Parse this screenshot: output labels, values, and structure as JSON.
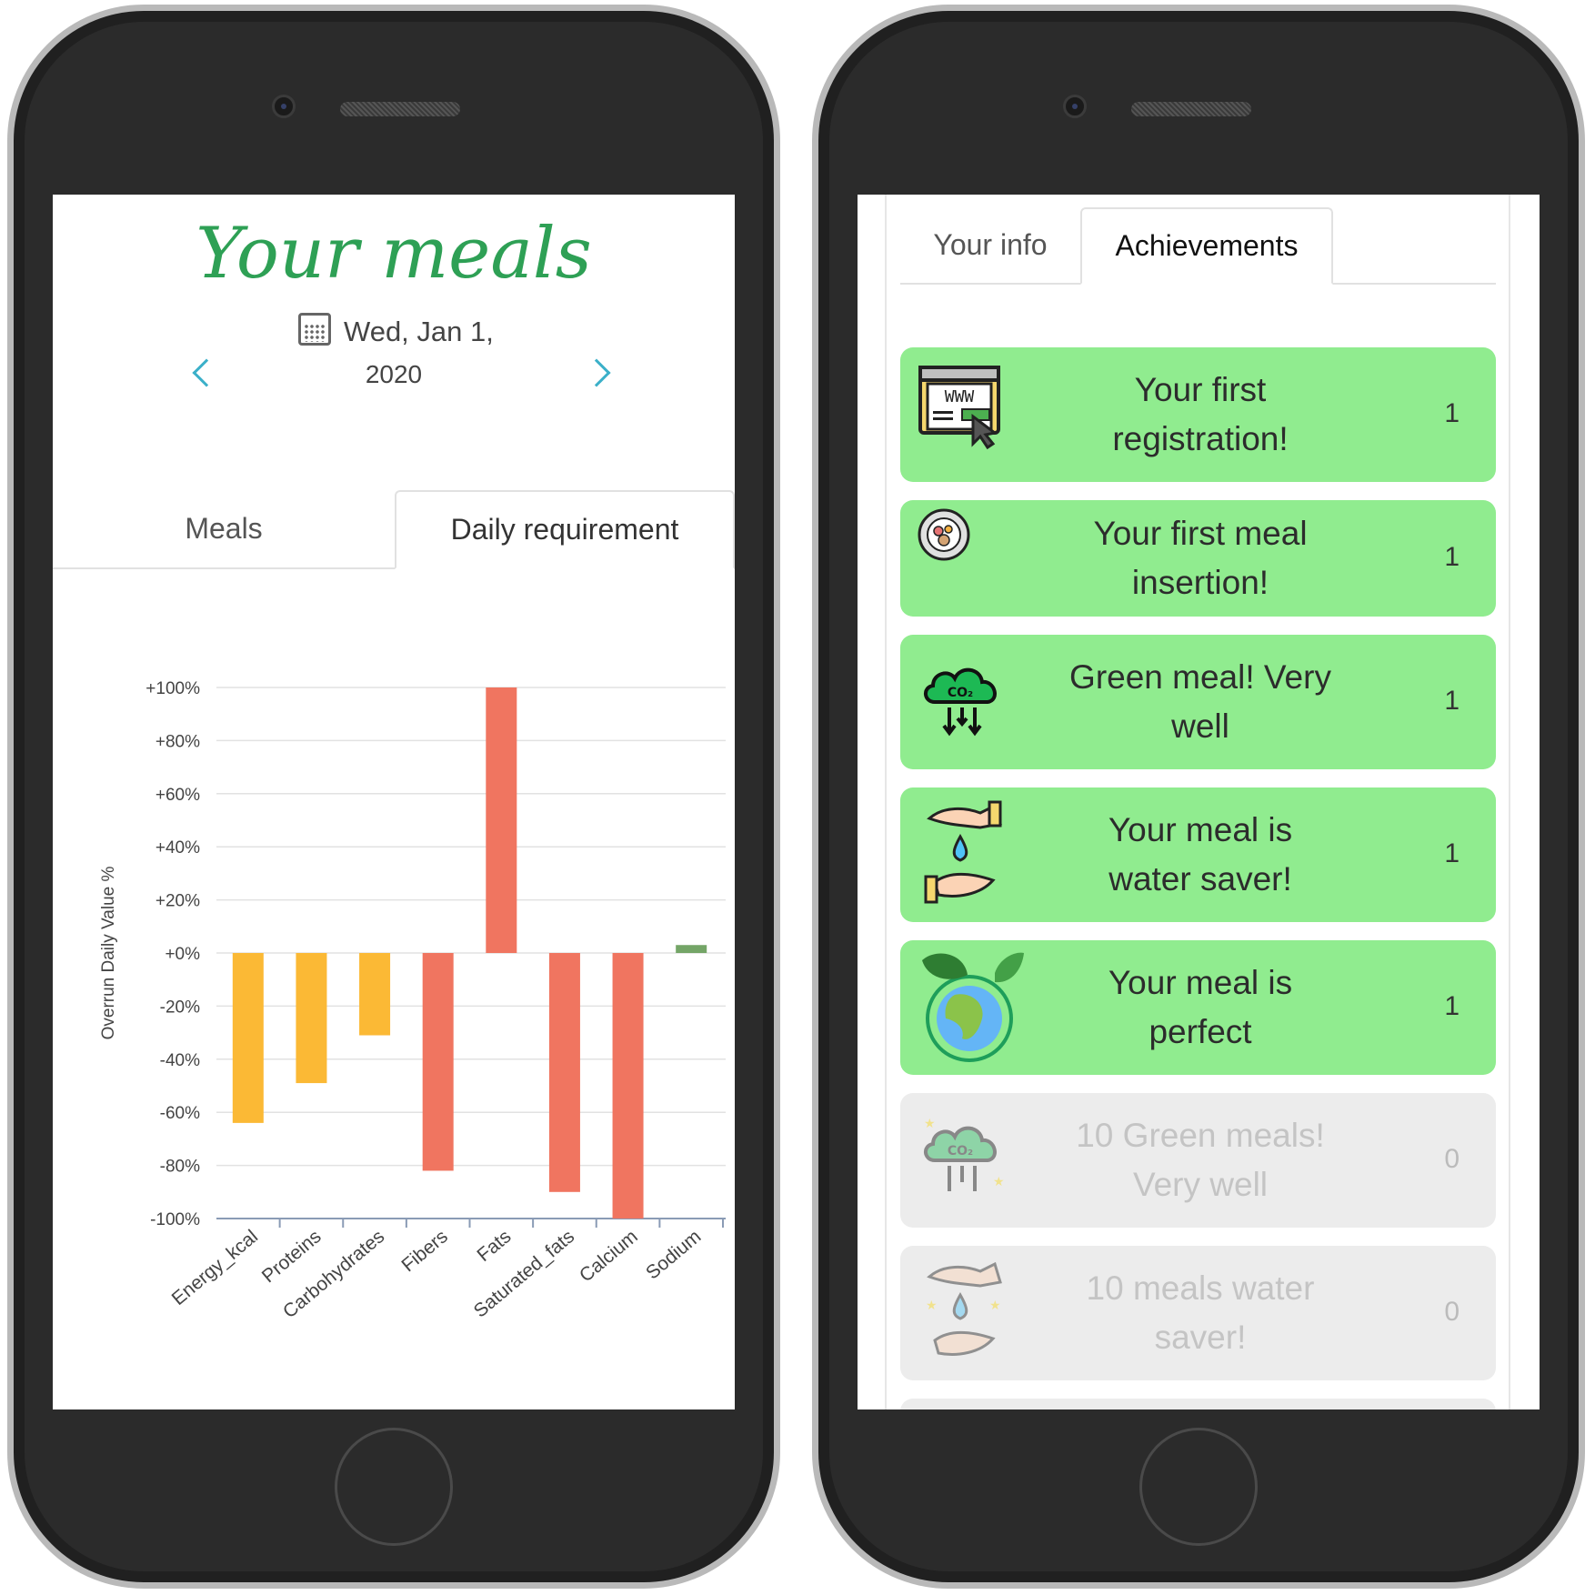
{
  "left_phone": {
    "title": "Your meals",
    "date_line1": "Wed, Jan 1,",
    "date_line2": "2020",
    "tabs": [
      {
        "label": "Meals",
        "active": false
      },
      {
        "label": "Daily requirement",
        "active": true
      }
    ]
  },
  "right_phone": {
    "tabs": [
      {
        "label": "Your info",
        "active": false
      },
      {
        "label": "Achievements",
        "active": true
      }
    ],
    "achievements": [
      {
        "line1": "Your first",
        "line2": "registration!",
        "count": "1",
        "unlocked": true,
        "icon": "website-icon"
      },
      {
        "line1": "Your first meal",
        "line2": "insertion!",
        "count": "1",
        "unlocked": true,
        "icon": "meal-plate-icon"
      },
      {
        "line1": "Green meal! Very",
        "line2": "well",
        "count": "1",
        "unlocked": true,
        "icon": "co2-cloud-icon"
      },
      {
        "line1": "Your meal is",
        "line2": "water saver!",
        "count": "1",
        "unlocked": true,
        "icon": "water-hands-icon"
      },
      {
        "line1": "Your meal is",
        "line2": "perfect",
        "count": "1",
        "unlocked": true,
        "icon": "earth-leaves-icon"
      },
      {
        "line1": "10 Green meals!",
        "line2": "Very well",
        "count": "0",
        "unlocked": false,
        "icon": "co2-cloud-stars-icon"
      },
      {
        "line1": "10 meals water",
        "line2": "saver!",
        "count": "0",
        "unlocked": false,
        "icon": "water-hands-stars-icon"
      }
    ]
  },
  "colors": {
    "title_green": "#2ea055",
    "card_green": "#90ec8f",
    "card_locked": "#ececec",
    "bar_orange": "#fbb935",
    "bar_red": "#f07560",
    "bar_green": "#74a567",
    "nav_arrow": "#3bb0c9"
  },
  "chart_data": {
    "type": "bar",
    "ylabel": "Overrun Daily Value %",
    "ylim": [
      -100,
      100
    ],
    "y_ticks": [
      "+100%",
      "+80%",
      "+60%",
      "+40%",
      "+20%",
      "+0%",
      "-20%",
      "-40%",
      "-60%",
      "-80%",
      "-100%"
    ],
    "y_tick_values": [
      100,
      80,
      60,
      40,
      20,
      0,
      -20,
      -40,
      -60,
      -80,
      -100
    ],
    "categories": [
      "Energy_kcal",
      "Proteins",
      "Carbohydrates",
      "Fibers",
      "Fats",
      "Saturated_fats",
      "Calcium",
      "Sodium"
    ],
    "values": [
      -64,
      -49,
      -31,
      -82,
      100,
      -90,
      -100,
      3
    ],
    "bar_colors": [
      "#fbb935",
      "#fbb935",
      "#fbb935",
      "#f07560",
      "#f07560",
      "#f07560",
      "#f07560",
      "#74a567"
    ],
    "grid": true
  }
}
